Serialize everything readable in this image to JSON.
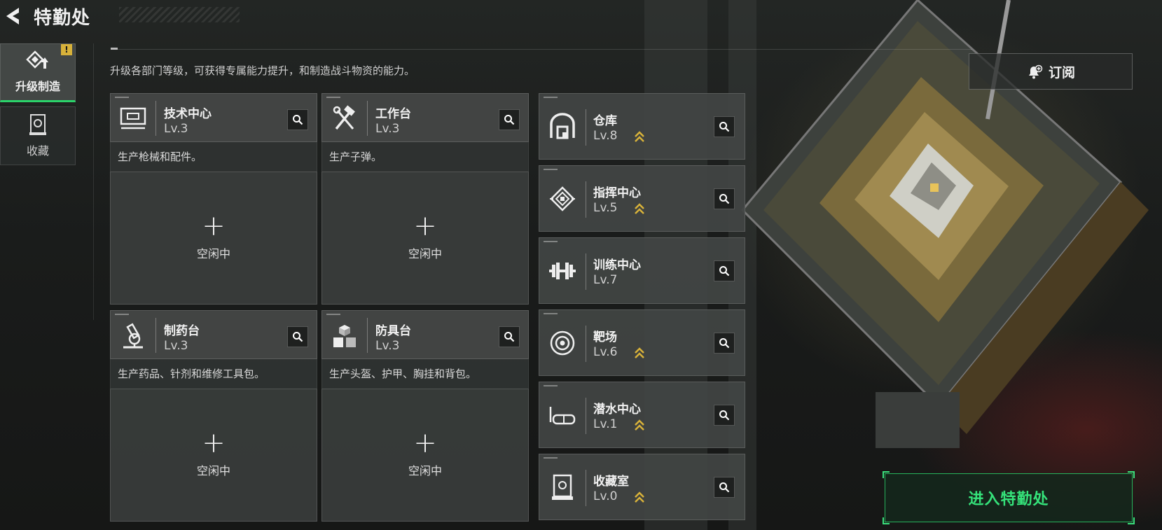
{
  "header": {
    "title": "特勤处"
  },
  "sidebar": {
    "items": [
      {
        "label": "升级制造",
        "active": true,
        "badge": "!"
      },
      {
        "label": "收藏",
        "active": false
      }
    ]
  },
  "subtitle": "升级各部门等级，可获得专属能力提升，和制造战斗物资的能力。",
  "production": [
    {
      "name": "技术中心",
      "level": "Lv.3",
      "desc": "生产枪械和配件。",
      "slot_plus": "+",
      "slot_status": "空闲中",
      "icon": "monitor-icon"
    },
    {
      "name": "工作台",
      "level": "Lv.3",
      "desc": "生产子弹。",
      "slot_plus": "+",
      "slot_status": "空闲中",
      "icon": "hammer-wrench-icon"
    },
    {
      "name": "制药台",
      "level": "Lv.3",
      "desc": "生产药品、针剂和维修工具包。",
      "slot_plus": "+",
      "slot_status": "空闲中",
      "icon": "microscope-icon"
    },
    {
      "name": "防具台",
      "level": "Lv.3",
      "desc": "生产头盔、护甲、胸挂和背包。",
      "slot_plus": "+",
      "slot_status": "空闲中",
      "icon": "boxes-icon"
    }
  ],
  "facilities": [
    {
      "name": "仓库",
      "level": "Lv.8",
      "upgradable": true,
      "icon": "warehouse-icon"
    },
    {
      "name": "指挥中心",
      "level": "Lv.5",
      "upgradable": true,
      "icon": "chip-icon"
    },
    {
      "name": "训练中心",
      "level": "Lv.7",
      "upgradable": false,
      "icon": "dumbbell-icon"
    },
    {
      "name": "靶场",
      "level": "Lv.6",
      "upgradable": true,
      "icon": "target-icon"
    },
    {
      "name": "潜水中心",
      "level": "Lv.1",
      "upgradable": true,
      "icon": "diving-mask-icon"
    },
    {
      "name": "收藏室",
      "level": "Lv.0",
      "upgradable": true,
      "icon": "trophy-case-icon"
    }
  ],
  "subscribe": {
    "label": "订阅",
    "icon": "bell-plus-icon"
  },
  "enter": {
    "label": "进入特勤处"
  },
  "colors": {
    "accent_green": "#35e27a",
    "upgrade_gold": "#d8b23a",
    "badge": "#d8b23a"
  }
}
